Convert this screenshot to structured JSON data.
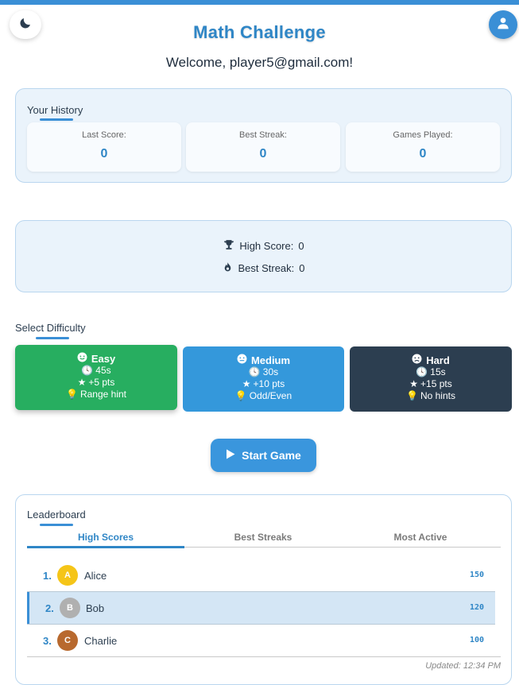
{
  "app": {
    "title": "Math Challenge",
    "welcome": "Welcome, player5@gmail.com!"
  },
  "header": {
    "theme_icon": "moon-icon",
    "user_icon": "user-icon"
  },
  "history": {
    "label": "Your History",
    "stats": [
      {
        "label": "Last Score:",
        "value": "0"
      },
      {
        "label": "Best Streak:",
        "value": "0"
      },
      {
        "label": "Games Played:",
        "value": "0"
      }
    ]
  },
  "records": {
    "high_score_label": "High Score:",
    "high_score_value": "0",
    "best_streak_label": "Best Streak:",
    "best_streak_value": "0"
  },
  "difficulty": {
    "label": "Select Difficulty",
    "options": [
      {
        "name": "Easy",
        "time": "45s",
        "points": "+5 pts",
        "hint": "Range hint",
        "color": "#27ae60",
        "face": "smile"
      },
      {
        "name": "Medium",
        "time": "30s",
        "points": "+10 pts",
        "hint": "Odd/Even",
        "color": "#3498db",
        "face": "neutral"
      },
      {
        "name": "Hard",
        "time": "15s",
        "points": "+15 pts",
        "hint": "No hints",
        "color": "#2c3e50",
        "face": "frown"
      }
    ]
  },
  "start_button": {
    "label": "Start Game"
  },
  "leaderboard": {
    "label": "Leaderboard",
    "tabs": [
      "High Scores",
      "Best Streaks",
      "Most Active"
    ],
    "active_tab": "High Scores",
    "rows": [
      {
        "rank": "1.",
        "initial": "A",
        "name": "Alice",
        "score": "150",
        "avatar_color": "#f5c518"
      },
      {
        "rank": "2.",
        "initial": "B",
        "name": "Bob",
        "score": "120",
        "avatar_color": "#b0b0b0"
      },
      {
        "rank": "3.",
        "initial": "C",
        "name": "Charlie",
        "score": "100",
        "avatar_color": "#b8692e"
      }
    ],
    "updated": "Updated: 12:34 PM"
  }
}
